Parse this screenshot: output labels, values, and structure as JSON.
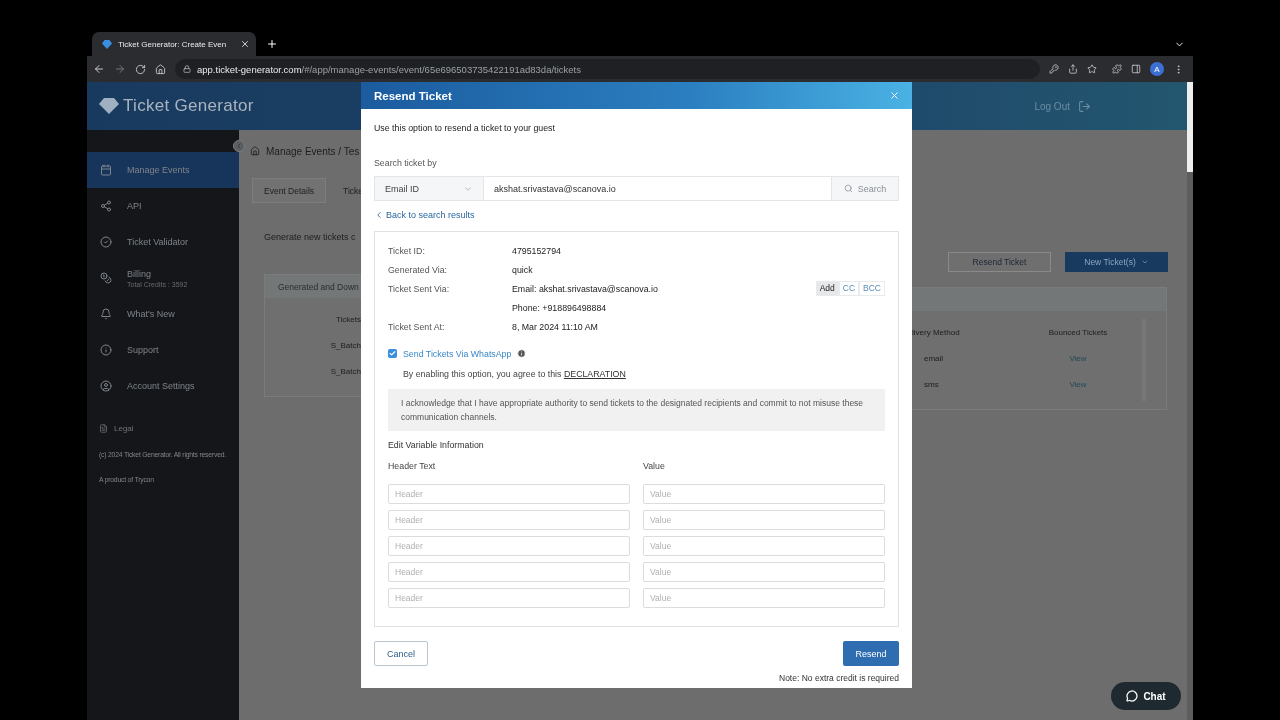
{
  "browser": {
    "tab_title": "Ticket Generator: Create Even",
    "url_host": "app.ticket-generator.com",
    "url_path": "/#/app/manage-events/event/65e696503735422191ad83da/tickets",
    "profile_initial": "A"
  },
  "header": {
    "logo": "Ticket Generator",
    "logout": "Log Out"
  },
  "sidebar": {
    "items": [
      {
        "label": "Manage Events",
        "selected": true
      },
      {
        "label": "API",
        "selected": false
      },
      {
        "label": "Ticket Validator",
        "selected": false
      },
      {
        "label": "Billing",
        "sublabel": "Total Credits : 3592",
        "selected": false
      },
      {
        "label": "What's New",
        "selected": false
      },
      {
        "label": "Support",
        "selected": false
      },
      {
        "label": "Account Settings",
        "selected": false
      }
    ],
    "legal": "Legal",
    "copyright": "(c) 2024 Ticket Generator. All rights reserved.",
    "credit": "A product of Trycon"
  },
  "page": {
    "breadcrumb": "Manage Events / Tes",
    "tabs": [
      {
        "label": "Event Details",
        "selected": false
      },
      {
        "label": "Ticke",
        "selected": true
      }
    ],
    "intro": "Generate new tickets c",
    "actions": [
      {
        "label": "Resend Ticket",
        "kind": "outline"
      },
      {
        "label": "New Ticket(s)",
        "kind": "primary"
      }
    ],
    "table": {
      "title": "Generated and Down",
      "left_column": "Tickets",
      "left_rows": [
        "S_Batch",
        "S_Batch"
      ],
      "right_columns": [
        "livery Method",
        "Bounced Tickets"
      ],
      "right_rows": [
        [
          "email",
          "View"
        ],
        [
          "sms",
          "View"
        ]
      ]
    }
  },
  "modal": {
    "title": "Resend Ticket",
    "intro": "Use this option to resend a ticket to your guest",
    "search_label": "Search ticket by",
    "search_by": "Email ID",
    "search_value": "akshat.srivastava@scanova.io",
    "search_button": "Search",
    "back_link": "Back to search results",
    "details": [
      {
        "label": "Ticket ID:",
        "value": "4795152794"
      },
      {
        "label": "Generated Via:",
        "value": "quick"
      },
      {
        "label": "Ticket Sent Via:",
        "value": "Email: akshat.srivastava@scanova.io",
        "addons": [
          {
            "label": "Add",
            "selected": true
          },
          {
            "label": "CC",
            "selected": false
          },
          {
            "label": "BCC",
            "selected": false
          }
        ]
      },
      {
        "value": "Phone: +918896498884"
      },
      {
        "label": "Ticket Sent At:",
        "value": "8, Mar 2024 11:10 AM"
      }
    ],
    "whatsapp": {
      "label": "Send Tickets Via WhatsApp",
      "checked": true
    },
    "consent": "By enabling this option, you agree to this",
    "consent_link": "DECLARATION",
    "acknowledgement": "I acknowledge that I have appropriate authority to send tickets to the designated recipients and commit to not misuse these communication channels.",
    "variables_title": "Edit Variable Information",
    "variable_columns": [
      "Header Text",
      "Value"
    ],
    "variable_rows": [
      {
        "header_placeholder": "Header",
        "value_placeholder": "Value"
      },
      {
        "header_placeholder": "Header",
        "value_placeholder": "Value"
      },
      {
        "header_placeholder": "Header",
        "value_placeholder": "Value"
      },
      {
        "header_placeholder": "Header",
        "value_placeholder": "Value"
      },
      {
        "header_placeholder": "Header",
        "value_placeholder": "Value"
      }
    ],
    "cancel": "Cancel",
    "submit": "Resend",
    "note": "Note: No extra credit is required"
  },
  "chat": {
    "label": "Chat"
  }
}
